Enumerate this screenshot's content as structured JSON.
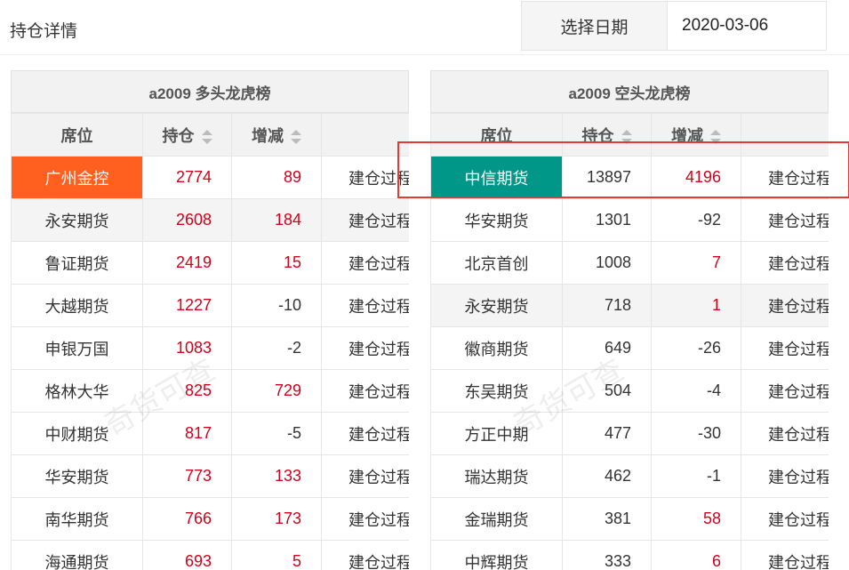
{
  "page": {
    "title": "持仓详情"
  },
  "date_picker": {
    "label": "选择日期",
    "value": "2020-03-06"
  },
  "long_panel": {
    "title": "a2009 多头龙虎榜",
    "headers": {
      "seat": "席位",
      "position": "持仓",
      "change": "增减"
    },
    "action_label": "建仓过程",
    "rows": [
      {
        "seat": "广州金控",
        "position": "2774",
        "change": "89"
      },
      {
        "seat": "永安期货",
        "position": "2608",
        "change": "184"
      },
      {
        "seat": "鲁证期货",
        "position": "2419",
        "change": "15"
      },
      {
        "seat": "大越期货",
        "position": "1227",
        "change": "-10"
      },
      {
        "seat": "申银万国",
        "position": "1083",
        "change": "-2"
      },
      {
        "seat": "格林大华",
        "position": "825",
        "change": "729"
      },
      {
        "seat": "中财期货",
        "position": "817",
        "change": "-5"
      },
      {
        "seat": "华安期货",
        "position": "773",
        "change": "133"
      },
      {
        "seat": "南华期货",
        "position": "766",
        "change": "173"
      },
      {
        "seat": "海通期货",
        "position": "693",
        "change": "5"
      }
    ]
  },
  "short_panel": {
    "title": "a2009 空头龙虎榜",
    "headers": {
      "seat": "席位",
      "position": "持仓",
      "change": "增减"
    },
    "action_label": "建仓过程",
    "rows": [
      {
        "seat": "中信期货",
        "position": "13897",
        "change": "4196"
      },
      {
        "seat": "华安期货",
        "position": "1301",
        "change": "-92"
      },
      {
        "seat": "北京首创",
        "position": "1008",
        "change": "7"
      },
      {
        "seat": "永安期货",
        "position": "718",
        "change": "1"
      },
      {
        "seat": "徽商期货",
        "position": "649",
        "change": "-26"
      },
      {
        "seat": "东吴期货",
        "position": "504",
        "change": "-4"
      },
      {
        "seat": "方正中期",
        "position": "477",
        "change": "-30"
      },
      {
        "seat": "瑞达期货",
        "position": "462",
        "change": "-1"
      },
      {
        "seat": "金瑞期货",
        "position": "381",
        "change": "58"
      },
      {
        "seat": "中辉期货",
        "position": "333",
        "change": "6"
      }
    ]
  },
  "watermark": {
    "text": "奇货可查"
  },
  "colors": {
    "highlight_long": "#ff5f1f",
    "highlight_short": "#009688",
    "positive": "#d0021b",
    "annotation": "#e53935"
  }
}
